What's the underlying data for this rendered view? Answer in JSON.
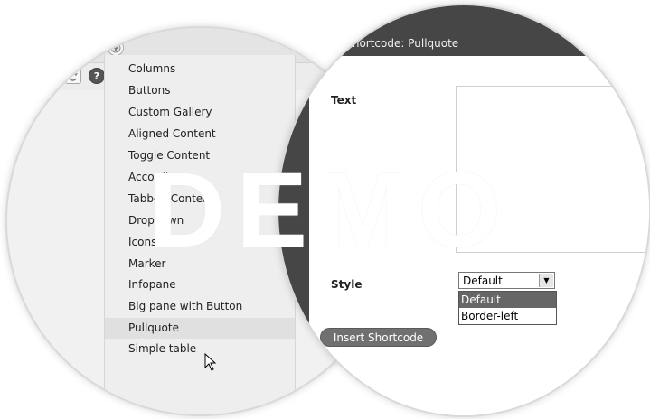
{
  "toolbar": {
    "add_icon": "plus-circle-icon",
    "table_icon": "table-icon",
    "undo_icon": "undo-icon",
    "redo_icon": "redo-icon",
    "help_icon": "question-icon",
    "help_glyph": "?"
  },
  "shortcode_menu": {
    "items": [
      {
        "label": "Columns"
      },
      {
        "label": "Buttons"
      },
      {
        "label": "Custom Gallery"
      },
      {
        "label": "Aligned Content"
      },
      {
        "label": "Toggle Content"
      },
      {
        "label": "Accordion"
      },
      {
        "label": "Tabbed Content"
      },
      {
        "label": "Dropdown"
      },
      {
        "label": "Icons"
      },
      {
        "label": "Marker"
      },
      {
        "label": "Infopane"
      },
      {
        "label": "Big pane with Button"
      },
      {
        "label": "Pullquote"
      },
      {
        "label": "Simple table"
      }
    ],
    "hovered_item": "Pullquote"
  },
  "dialog": {
    "title": "Insert Shortcode: Pullquote",
    "text_label": "Text",
    "text_value": "",
    "style_label": "Style",
    "style_selected": "Default",
    "style_options": [
      {
        "label": "Default",
        "selected": true
      },
      {
        "label": "Border-left",
        "selected": false
      }
    ],
    "insert_button_label": "Insert Shortcode"
  },
  "watermark": "DEMO",
  "colors": {
    "dialog_header": "#464646",
    "menu_background": "#eeeeee",
    "button": "#707070"
  }
}
